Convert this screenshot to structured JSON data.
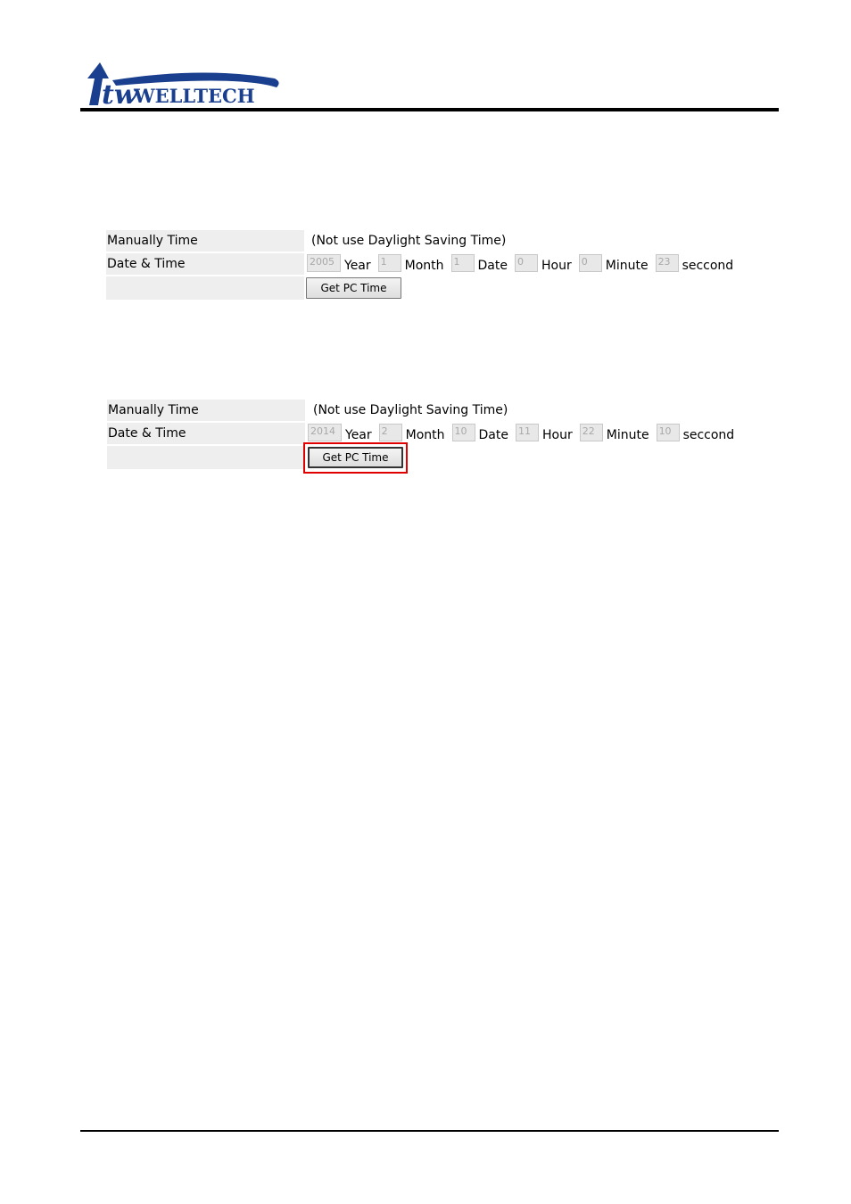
{
  "header": {
    "logo_text": "WELLTECH",
    "logo_mark": "tw"
  },
  "colors": {
    "logo_blue": "#1a3f8f",
    "label_bg": "#eeeeee",
    "highlight": "#e00000"
  },
  "panels": [
    {
      "manual_label": "Manually Time",
      "manual_note": "(Not use Daylight Saving Time)",
      "datetime_label": "Date & Time",
      "fields": [
        {
          "value": "2005",
          "unit": "Year"
        },
        {
          "value": "1",
          "unit": "Month"
        },
        {
          "value": "1",
          "unit": "Date"
        },
        {
          "value": "0",
          "unit": "Hour"
        },
        {
          "value": "0",
          "unit": "Minute"
        },
        {
          "value": "23",
          "unit": "seccond"
        }
      ],
      "button_label": "Get PC Time"
    },
    {
      "manual_label": "Manually Time",
      "manual_note": "(Not use Daylight Saving Time)",
      "datetime_label": "Date & Time",
      "fields": [
        {
          "value": "2014",
          "unit": "Year"
        },
        {
          "value": "2",
          "unit": "Month"
        },
        {
          "value": "10",
          "unit": "Date"
        },
        {
          "value": "11",
          "unit": "Hour"
        },
        {
          "value": "22",
          "unit": "Minute"
        },
        {
          "value": "10",
          "unit": "seccond"
        }
      ],
      "button_label": "Get PC Time",
      "button_highlighted": true
    }
  ]
}
